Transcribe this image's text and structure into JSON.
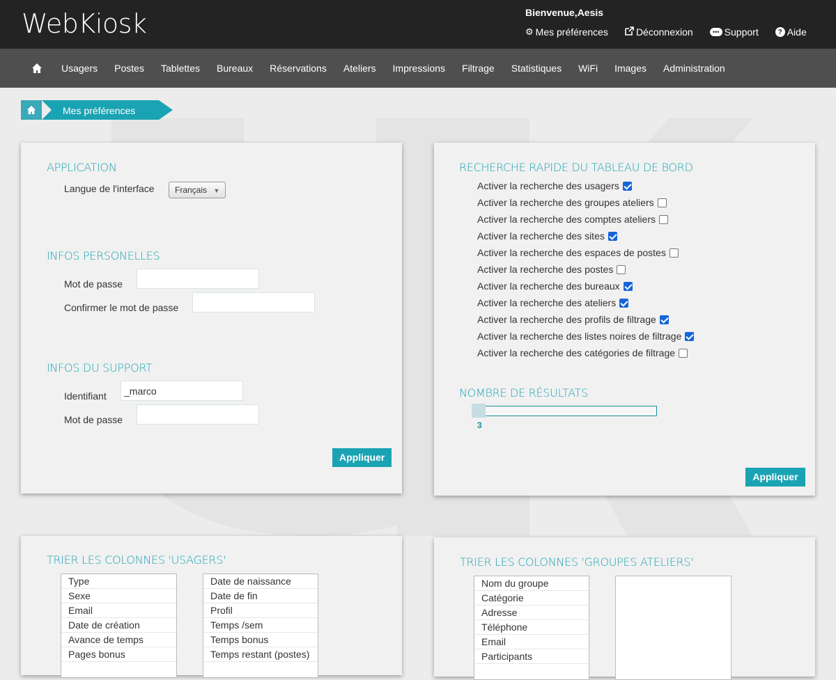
{
  "header": {
    "logo": "WebKiosk",
    "welcome": "Bienvenue,Aesis",
    "links": [
      {
        "icon": "gear-icon",
        "label": "Mes préférences"
      },
      {
        "icon": "external-link-icon",
        "label": "Déconnexion"
      },
      {
        "icon": "chat-bubble-icon",
        "label": "Support"
      },
      {
        "icon": "help-icon",
        "label": "Aide"
      }
    ]
  },
  "nav": {
    "home_icon": "home-icon",
    "items": [
      "Usagers",
      "Postes",
      "Tablettes",
      "Bureaux",
      "Réservations",
      "Ateliers",
      "Impressions",
      "Filtrage",
      "Statistiques",
      "WiFi",
      "Images",
      "Administration"
    ]
  },
  "breadcrumb": {
    "label": "Mes préférences"
  },
  "application": {
    "title": "APPLICATION",
    "language_label": "Langue de l'interface",
    "language_value": "Français"
  },
  "personal": {
    "title": "INFOS PERSONELLES",
    "password_label": "Mot de passe",
    "password_value": "",
    "confirm_label": "Confirmer le mot de passe",
    "confirm_value": ""
  },
  "support": {
    "title": "INFOS DU SUPPORT",
    "id_label": "Identifiant",
    "id_value": "_marco",
    "password_label": "Mot de passe",
    "password_value": ""
  },
  "left_apply": "Appliquer",
  "search": {
    "title": "RECHERCHE RAPIDE DU TABLEAU DE BORD",
    "options": [
      {
        "label": "Activer la recherche des usagers",
        "checked": true
      },
      {
        "label": "Activer la recherche des groupes ateliers",
        "checked": false
      },
      {
        "label": "Activer la recherche des comptes ateliers",
        "checked": false
      },
      {
        "label": "Activer la recherche des sites",
        "checked": true
      },
      {
        "label": "Activer la recherche des espaces de postes",
        "checked": false
      },
      {
        "label": "Activer la recherche des postes",
        "checked": false
      },
      {
        "label": "Activer la recherche des bureaux",
        "checked": true
      },
      {
        "label": "Activer la recherche des ateliers",
        "checked": true
      },
      {
        "label": "Activer la recherche des profils de filtrage",
        "checked": true
      },
      {
        "label": "Activer la recherche des listes noires de filtrage",
        "checked": true
      },
      {
        "label": "Activer la recherche des catégories de filtrage",
        "checked": false
      }
    ],
    "results_title": "NOMBRE DE RÉSULTATS",
    "results_value": "3",
    "apply": "Appliquer"
  },
  "sort_users": {
    "title": "TRIER LES COLONNES 'USAGERS'",
    "left": [
      "Type",
      "Sexe",
      "Email",
      "Date de création",
      "Avance de temps",
      "Pages bonus"
    ],
    "right": [
      "Date de naissance",
      "Date de fin",
      "Profil",
      "Temps /sem",
      "Temps bonus",
      "Temps restant (postes)"
    ]
  },
  "sort_groups": {
    "title": "TRIER LES COLONNES 'GROUPES ATELIERS'",
    "left": [
      "Nom du groupe",
      "Catégorie",
      "Adresse",
      "Téléphone",
      "Email",
      "Participants"
    ],
    "right": []
  }
}
